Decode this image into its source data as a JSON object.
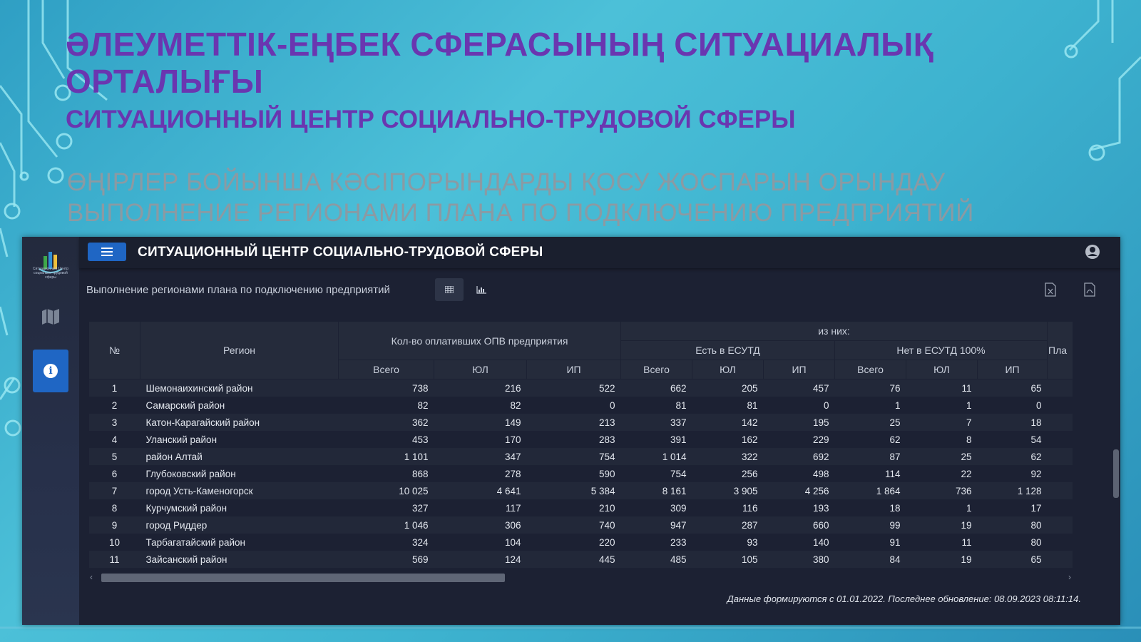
{
  "slide": {
    "title_kz": "ӘЛЕУМЕТТІК-ЕҢБЕК СФЕРАСЫНЫҢ СИТУАЦИАЛЫҚ ОРТАЛЫҒЫ",
    "title_ru": "СИТУАЦИОННЫЙ ЦЕНТР СОЦИАЛЬНО-ТРУДОВОЙ СФЕРЫ",
    "subtitle_kz": "ӨҢІРЛЕР БОЙЫНША КӘСІПОРЫНДАРДЫ ҚОСУ ЖОСПАРЫН ОРЫНДАУ",
    "subtitle_ru": "ВЫПОЛНЕНИЕ РЕГИОНАМИ ПЛАНА ПО ПОДКЛЮЧЕНИЮ ПРЕДПРИЯТИЙ"
  },
  "app": {
    "title": "СИТУАЦИОННЫЙ ЦЕНТР СОЦИАЛЬНО-ТРУДОВОЙ СФЕРЫ",
    "logo_text": "Ситуационный Центр социально-трудовой сферы",
    "accent_color": "#1f66c4",
    "background_color": "#1c2133"
  },
  "report": {
    "title": "Выполнение регионами плана по подключению предприятий",
    "footer": "Данные формируются с 01.01.2022. Последнее обновление: 08.09.2023 08:11:14."
  },
  "table": {
    "headers": {
      "num": "№",
      "region": "Регион",
      "paid_group": "Кол-во оплативших ОПВ предприятия",
      "of_them": "из них:",
      "in_esutd": "Есть в ЕСУТД",
      "not_in_esutd": "Нет в ЕСУТД 100%",
      "total": "Всего",
      "yl": "ЮЛ",
      "ip": "ИП",
      "plan_truncated": "Пла"
    },
    "rows": [
      {
        "n": "1",
        "region": "Шемонаихинский район",
        "t": "738",
        "y": "216",
        "i": "522",
        "et": "662",
        "ey": "205",
        "ei": "457",
        "nt": "76",
        "ny": "11",
        "ni": "65"
      },
      {
        "n": "2",
        "region": "Самарский район",
        "t": "82",
        "y": "82",
        "i": "0",
        "et": "81",
        "ey": "81",
        "ei": "0",
        "nt": "1",
        "ny": "1",
        "ni": "0"
      },
      {
        "n": "3",
        "region": "Катон-Карагайский район",
        "t": "362",
        "y": "149",
        "i": "213",
        "et": "337",
        "ey": "142",
        "ei": "195",
        "nt": "25",
        "ny": "7",
        "ni": "18"
      },
      {
        "n": "4",
        "region": "Уланский район",
        "t": "453",
        "y": "170",
        "i": "283",
        "et": "391",
        "ey": "162",
        "ei": "229",
        "nt": "62",
        "ny": "8",
        "ni": "54"
      },
      {
        "n": "5",
        "region": "район Алтай",
        "t": "1 101",
        "y": "347",
        "i": "754",
        "et": "1 014",
        "ey": "322",
        "ei": "692",
        "nt": "87",
        "ny": "25",
        "ni": "62"
      },
      {
        "n": "6",
        "region": "Глубоковский район",
        "t": "868",
        "y": "278",
        "i": "590",
        "et": "754",
        "ey": "256",
        "ei": "498",
        "nt": "114",
        "ny": "22",
        "ni": "92"
      },
      {
        "n": "7",
        "region": "город Усть-Каменогорск",
        "t": "10 025",
        "y": "4 641",
        "i": "5 384",
        "et": "8 161",
        "ey": "3 905",
        "ei": "4 256",
        "nt": "1 864",
        "ny": "736",
        "ni": "1 128"
      },
      {
        "n": "8",
        "region": "Курчумский район",
        "t": "327",
        "y": "117",
        "i": "210",
        "et": "309",
        "ey": "116",
        "ei": "193",
        "nt": "18",
        "ny": "1",
        "ni": "17"
      },
      {
        "n": "9",
        "region": "город Риддер",
        "t": "1 046",
        "y": "306",
        "i": "740",
        "et": "947",
        "ey": "287",
        "ei": "660",
        "nt": "99",
        "ny": "19",
        "ni": "80"
      },
      {
        "n": "10",
        "region": "Тарбагатайский район",
        "t": "324",
        "y": "104",
        "i": "220",
        "et": "233",
        "ey": "93",
        "ei": "140",
        "nt": "91",
        "ny": "11",
        "ni": "80"
      },
      {
        "n": "11",
        "region": "Зайсанский район",
        "t": "569",
        "y": "124",
        "i": "445",
        "et": "485",
        "ey": "105",
        "ei": "380",
        "nt": "84",
        "ny": "19",
        "ni": "65"
      }
    ]
  },
  "icons": {
    "menu": "hamburger-icon",
    "user": "user-circle-icon",
    "map": "map-icon",
    "info": "info-icon",
    "table_view": "table-icon",
    "chart_view": "bar-chart-icon",
    "export_excel": "excel-file-icon",
    "export_pdf": "pdf-file-icon"
  }
}
